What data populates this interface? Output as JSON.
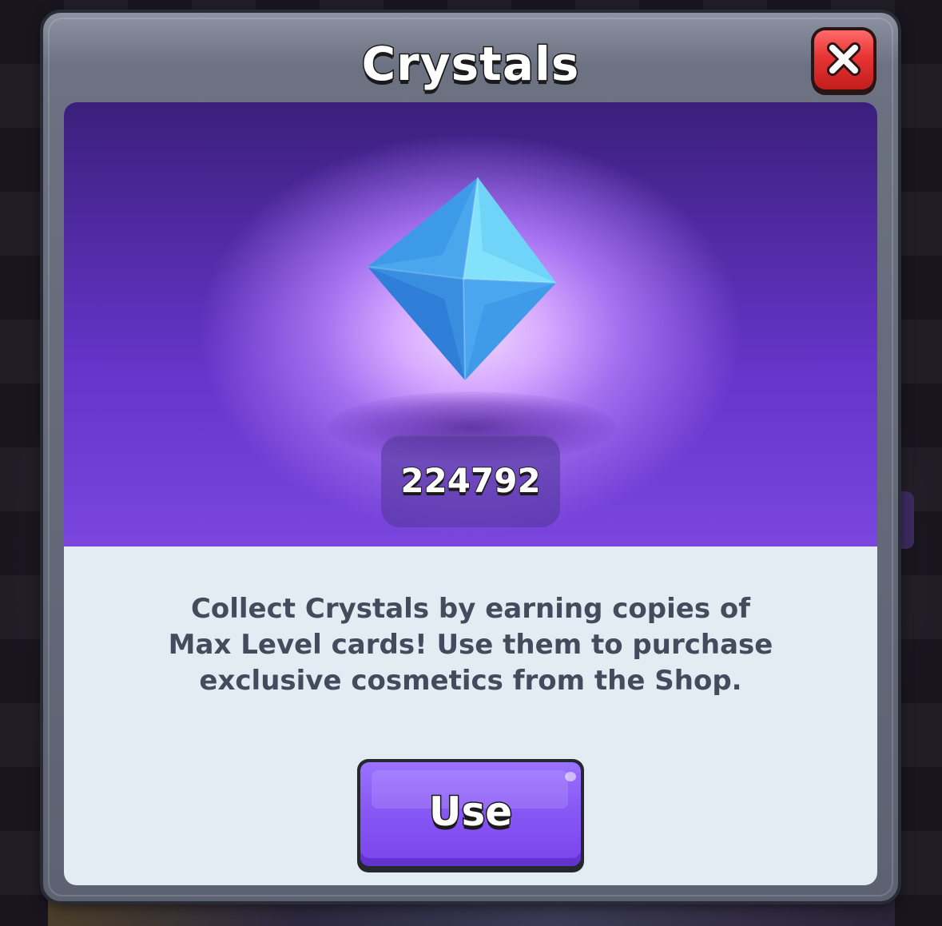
{
  "dialog": {
    "title": "Crystals",
    "close_icon": "close-x-icon"
  },
  "crystal": {
    "icon": "crystal-star-icon",
    "count": "224792"
  },
  "description": {
    "line1": "Collect Crystals by earning copies of",
    "line2": "Max Level cards! Use them to purchase",
    "line3": "exclusive cosmetics from the Shop."
  },
  "actions": {
    "use_label": "Use"
  },
  "colors": {
    "accent_purple": "#8858f4",
    "close_red": "#e83434",
    "panel_bg": "#e2ecf2",
    "text_dark": "#434b5c"
  }
}
